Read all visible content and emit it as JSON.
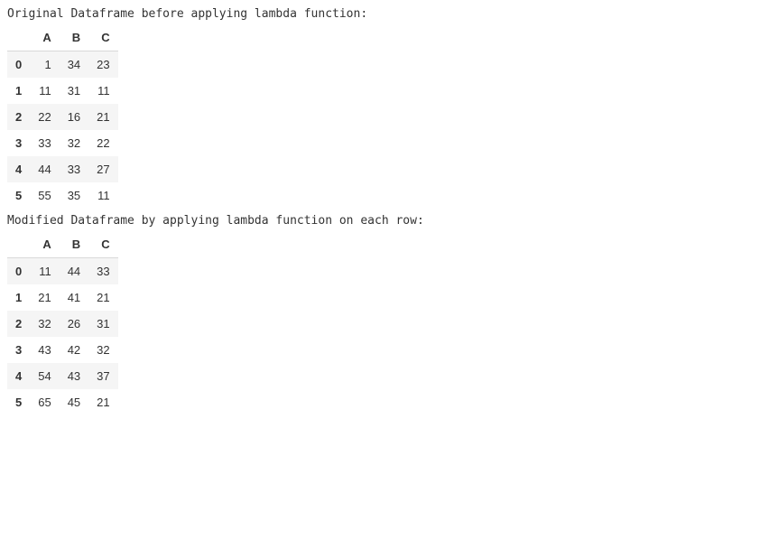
{
  "captions": {
    "before": "Original Dataframe before applying lambda function:",
    "after": "Modified Dataframe by applying lambda function on each row:"
  },
  "tables": {
    "before": {
      "columns": [
        "A",
        "B",
        "C"
      ],
      "index": [
        "0",
        "1",
        "2",
        "3",
        "4",
        "5"
      ],
      "rows": [
        [
          1,
          34,
          23
        ],
        [
          11,
          31,
          11
        ],
        [
          22,
          16,
          21
        ],
        [
          33,
          32,
          22
        ],
        [
          44,
          33,
          27
        ],
        [
          55,
          35,
          11
        ]
      ]
    },
    "after": {
      "columns": [
        "A",
        "B",
        "C"
      ],
      "index": [
        "0",
        "1",
        "2",
        "3",
        "4",
        "5"
      ],
      "rows": [
        [
          11,
          44,
          33
        ],
        [
          21,
          41,
          21
        ],
        [
          32,
          26,
          31
        ],
        [
          43,
          42,
          32
        ],
        [
          54,
          43,
          37
        ],
        [
          65,
          45,
          21
        ]
      ]
    }
  },
  "chart_data": [
    {
      "type": "table",
      "title": "Original Dataframe before applying lambda function",
      "columns": [
        "A",
        "B",
        "C"
      ],
      "index": [
        0,
        1,
        2,
        3,
        4,
        5
      ],
      "values": [
        [
          1,
          34,
          23
        ],
        [
          11,
          31,
          11
        ],
        [
          22,
          16,
          21
        ],
        [
          33,
          32,
          22
        ],
        [
          44,
          33,
          27
        ],
        [
          55,
          35,
          11
        ]
      ]
    },
    {
      "type": "table",
      "title": "Modified Dataframe by applying lambda function on each row",
      "columns": [
        "A",
        "B",
        "C"
      ],
      "index": [
        0,
        1,
        2,
        3,
        4,
        5
      ],
      "values": [
        [
          11,
          44,
          33
        ],
        [
          21,
          41,
          21
        ],
        [
          32,
          26,
          31
        ],
        [
          43,
          42,
          32
        ],
        [
          54,
          43,
          37
        ],
        [
          65,
          45,
          21
        ]
      ]
    }
  ]
}
